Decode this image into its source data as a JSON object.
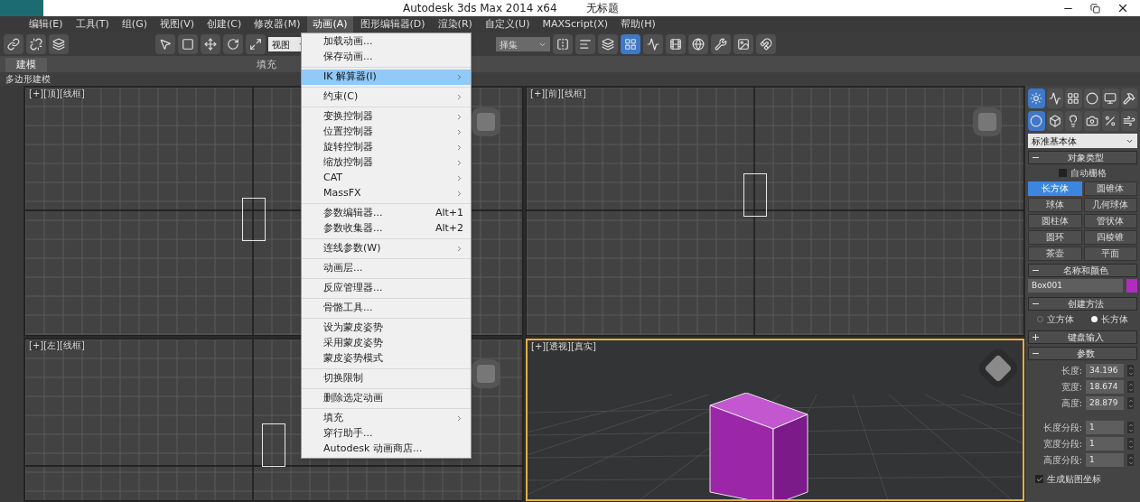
{
  "window": {
    "title": "Autodesk 3ds Max  2014 x64",
    "document": "无标题"
  },
  "menu_bar": [
    {
      "label": "编辑(E)",
      "selected": false
    },
    {
      "label": "工具(T)",
      "selected": false
    },
    {
      "label": "组(G)",
      "selected": false
    },
    {
      "label": "视图(V)",
      "selected": false
    },
    {
      "label": "创建(C)",
      "selected": false
    },
    {
      "label": "修改器(M)",
      "selected": false
    },
    {
      "label": "动画(A)",
      "selected": true
    },
    {
      "label": "图形编辑器(D)",
      "selected": false
    },
    {
      "label": "渲染(R)",
      "selected": false
    },
    {
      "label": "自定义(U)",
      "selected": false
    },
    {
      "label": "MAXScript(X)",
      "selected": false
    },
    {
      "label": "帮助(H)",
      "selected": false
    }
  ],
  "toolbar": {
    "view_dropdown": "视图",
    "selection_set_dropdown": "择集"
  },
  "ribbon": {
    "tabs": [
      {
        "label": "建模",
        "selected": true
      },
      {
        "label": "填充",
        "selected": false
      }
    ],
    "panel_label": "多边形建模"
  },
  "animation_menu": [
    [
      {
        "label": "加载动画...",
        "submenu": false,
        "selected": false
      },
      {
        "label": "保存动画...",
        "submenu": false,
        "selected": false
      }
    ],
    [
      {
        "label": "IK 解算器(I)",
        "submenu": true,
        "selected": true
      }
    ],
    [
      {
        "label": "约束(C)",
        "submenu": true,
        "selected": false
      }
    ],
    [
      {
        "label": "变换控制器",
        "submenu": true,
        "selected": false
      },
      {
        "label": "位置控制器",
        "submenu": true,
        "selected": false
      },
      {
        "label": "旋转控制器",
        "submenu": true,
        "selected": false
      },
      {
        "label": "缩放控制器",
        "submenu": true,
        "selected": false
      },
      {
        "label": "CAT",
        "submenu": true,
        "selected": false
      },
      {
        "label": "MassFX",
        "submenu": true,
        "selected": false
      }
    ],
    [
      {
        "label": "参数编辑器...",
        "shortcut": "Alt+1",
        "submenu": false,
        "selected": false
      },
      {
        "label": "参数收集器...",
        "shortcut": "Alt+2",
        "submenu": false,
        "selected": false
      }
    ],
    [
      {
        "label": "连线参数(W)",
        "submenu": true,
        "selected": false
      }
    ],
    [
      {
        "label": "动画层...",
        "submenu": false,
        "selected": false
      }
    ],
    [
      {
        "label": "反应管理器...",
        "submenu": false,
        "selected": false
      }
    ],
    [
      {
        "label": "骨骼工具...",
        "submenu": false,
        "selected": false
      }
    ],
    [
      {
        "label": "设为蒙皮姿势",
        "submenu": false,
        "selected": false
      },
      {
        "label": "采用蒙皮姿势",
        "submenu": false,
        "selected": false
      },
      {
        "label": "蒙皮姿势模式",
        "submenu": false,
        "selected": false
      }
    ],
    [
      {
        "label": "切换限制",
        "submenu": false,
        "selected": false
      }
    ],
    [
      {
        "label": "删除选定动画",
        "submenu": false,
        "selected": false
      }
    ],
    [
      {
        "label": "填充",
        "submenu": true,
        "selected": false
      },
      {
        "label": "穿行助手...",
        "submenu": false,
        "selected": false
      },
      {
        "label": "Autodesk 动画商店...",
        "submenu": false,
        "selected": false
      }
    ]
  ],
  "viewports": [
    {
      "label": "[+][顶][线框]",
      "kind": "wire",
      "selected": false
    },
    {
      "label": "[+][前][线框]",
      "kind": "wire",
      "selected": false
    },
    {
      "label": "[+][左][线框]",
      "kind": "wire",
      "selected": false
    },
    {
      "label": "[+][透视][真实]",
      "kind": "shaded",
      "selected": true
    }
  ],
  "command_panel": {
    "category_dropdown": "标准基本体",
    "object_type": {
      "title": "对象类型",
      "expanded": true,
      "autogrid": {
        "label": "自动栅格",
        "checked": false
      },
      "buttons": [
        {
          "label": "长方体",
          "selected": true
        },
        {
          "label": "圆锥体",
          "selected": false
        },
        {
          "label": "球体",
          "selected": false
        },
        {
          "label": "几何球体",
          "selected": false
        },
        {
          "label": "圆柱体",
          "selected": false
        },
        {
          "label": "管状体",
          "selected": false
        },
        {
          "label": "圆环",
          "selected": false
        },
        {
          "label": "四棱锥",
          "selected": false
        },
        {
          "label": "茶壶",
          "selected": false
        },
        {
          "label": "平面",
          "selected": false
        }
      ]
    },
    "name_color": {
      "title": "名称和颜色",
      "expanded": true,
      "name": "Box001",
      "color": "#b02cc0"
    },
    "creation_method": {
      "title": "创建方法",
      "expanded": true,
      "options": [
        {
          "label": "立方体",
          "selected": false
        },
        {
          "label": "长方体",
          "selected": true
        }
      ]
    },
    "keyboard_entry": {
      "title": "键盘输入",
      "expanded": false
    },
    "parameters": {
      "title": "参数",
      "expanded": true,
      "fields": [
        {
          "label": "长度:",
          "value": "34.196"
        },
        {
          "label": "宽度:",
          "value": "18.674"
        },
        {
          "label": "高度:",
          "value": "28.879"
        }
      ],
      "segments": [
        {
          "label": "长度分段:",
          "value": "1"
        },
        {
          "label": "宽度分段:",
          "value": "1"
        },
        {
          "label": "高度分段:",
          "value": "1"
        }
      ],
      "map_coords": {
        "label": "生成贴图坐标",
        "checked": true
      }
    }
  }
}
